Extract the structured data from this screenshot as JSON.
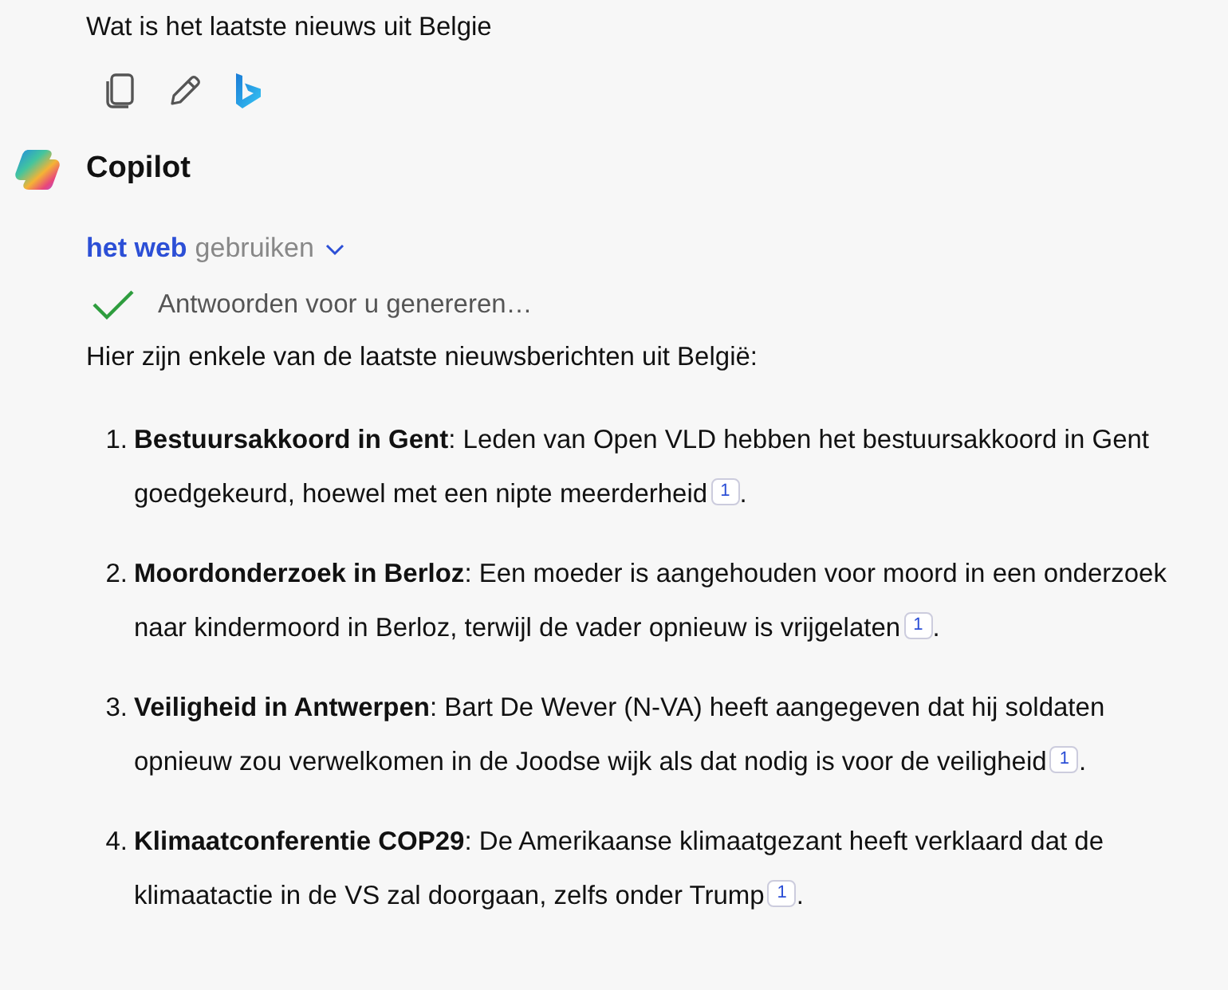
{
  "question": {
    "text": "Wat is het laatste nieuws uit Belgie"
  },
  "question_actions": [
    {
      "kind": "copy"
    },
    {
      "kind": "edit"
    },
    {
      "kind": "bing"
    }
  ],
  "assistant": {
    "name": "Copilot"
  },
  "web_toggle": {
    "highlight": "het web",
    "text": "gebruiken",
    "expanded": false
  },
  "progress": {
    "text": "Antwoorden voor u genereren…",
    "done": true
  },
  "intro": "Hier zijn enkele van de laatste nieuwsberichten uit België:",
  "items": [
    {
      "number": "1.",
      "text": "**Bestuursakkoord in Gent**: Leden van Open VLD hebben het bestuursakkoord in Gent goedgekeurd, hoewel met een nipte meerderheid",
      "citation": "1",
      "end": "."
    },
    {
      "number": "2.",
      "text": "**Moordonderzoek in Berloz**: Een moeder is aangehouden voor moord in een onderzoek naar kindermoord in Berloz, terwijl de vader opnieuw is vrijgelaten",
      "citation": "1",
      "end": "."
    },
    {
      "number": "3.",
      "text": "**Veiligheid in Antwerpen**: Bart De Wever (N-VA) heeft aangegeven dat hij soldaten opnieuw zou verwelkomen in de Joodse wijk als dat nodig is voor de veiligheid",
      "citation": "1",
      "end": "."
    },
    {
      "number": "4.",
      "text": "**Klimaatconferentie COP29**: De Amerikaanse klimaatgezant heeft verklaard dat de klimaatactie in de VS zal doorgaan, zelfs onder Trump",
      "citation": "1",
      "end": "."
    }
  ]
}
